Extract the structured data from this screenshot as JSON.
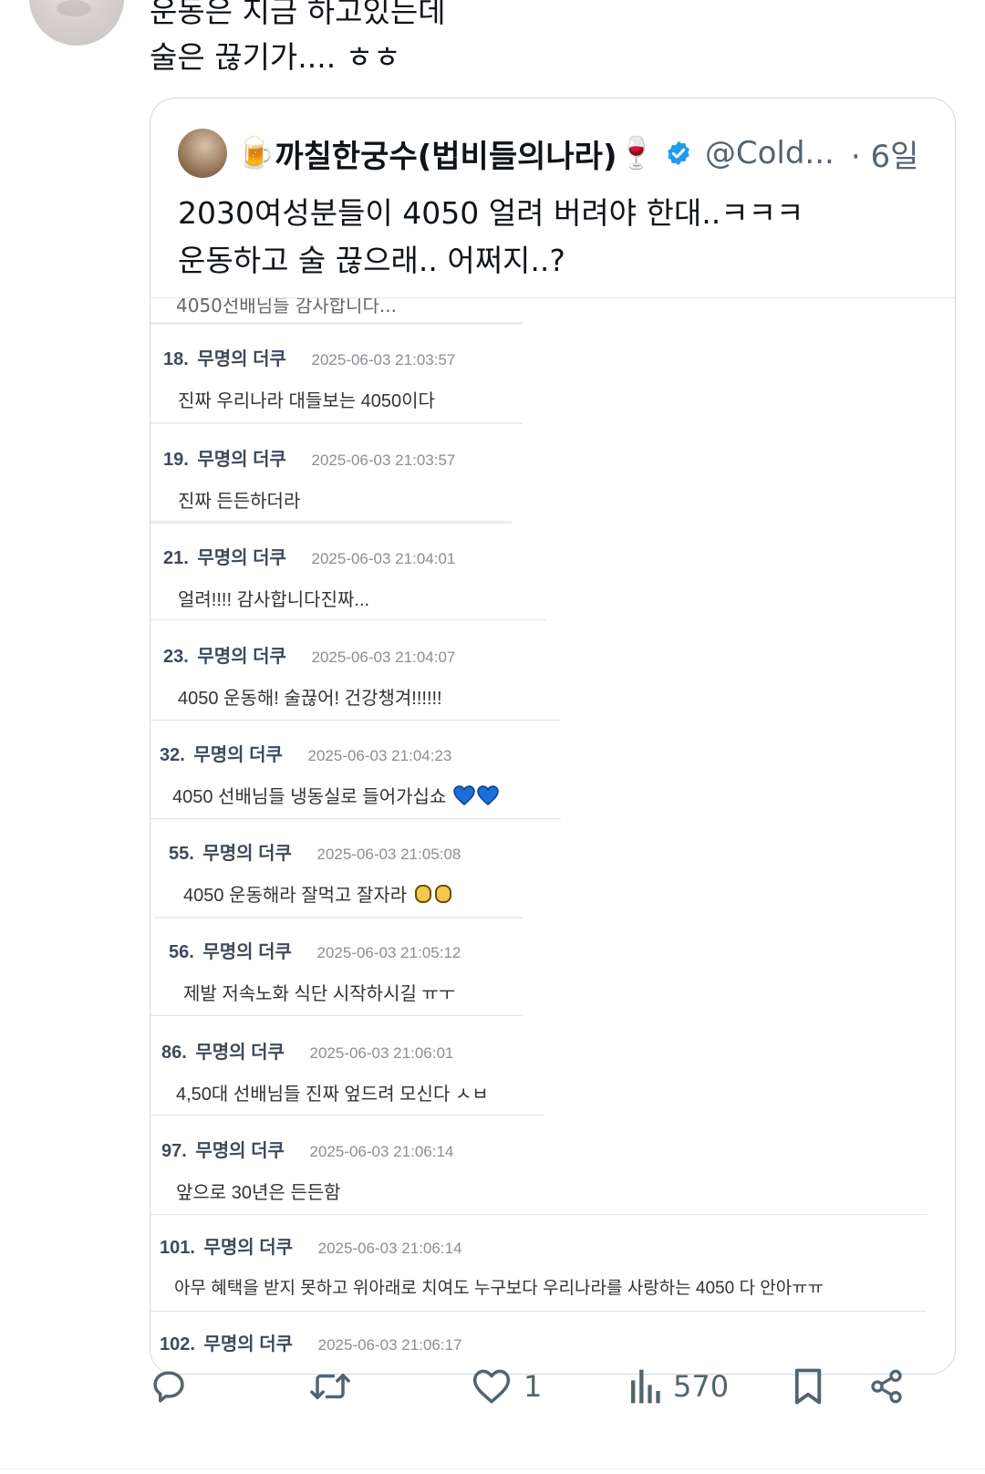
{
  "reply": {
    "line1": "운동은 지금 하고있는데",
    "line2": "술은 끊기가.... ㅎㅎ"
  },
  "quote": {
    "name_prefix_emoji": "🍺",
    "name": "까칠한궁수(법비들의나라)",
    "name_suffix_emoji": "🍷",
    "handle": "@Cold...",
    "time": "· 6일",
    "text_line1": "2030여성분들이 4050 얼려 버려야 한대..ㅋㅋㅋ",
    "text_line2": "운동하고 술 끊으래.. 어쩌지..?",
    "cut_top_text": "4050선배님들 감사합니다...",
    "comments": [
      {
        "num": "18.",
        "nick": "무명의 더쿠",
        "date": "2025-06-03 21:03:57",
        "body": "진짜 우리나라 대들보는 4050이다"
      },
      {
        "num": "19.",
        "nick": "무명의 더쿠",
        "date": "2025-06-03 21:03:57",
        "body": "진짜 든든하더라"
      },
      {
        "num": "21.",
        "nick": "무명의 더쿠",
        "date": "2025-06-03 21:04:01",
        "body": "얼려!!!! 감사합니다진짜..."
      },
      {
        "num": "23.",
        "nick": "무명의 더쿠",
        "date": "2025-06-03 21:04:07",
        "body": "4050 운동해! 술끊어! 건강챙겨!!!!!!"
      },
      {
        "num": "32.",
        "nick": "무명의 더쿠",
        "date": "2025-06-03 21:04:23",
        "body": "4050 선배님들 냉동실로 들어가십쇼"
      },
      {
        "num": "55.",
        "nick": "무명의 더쿠",
        "date": "2025-06-03 21:05:08",
        "body": "4050 운동해라 잘먹고 잘자라"
      },
      {
        "num": "56.",
        "nick": "무명의 더쿠",
        "date": "2025-06-03 21:05:12",
        "body": "제발 저속노화 식단 시작하시길 ㅠㅜ"
      },
      {
        "num": "86.",
        "nick": "무명의 더쿠",
        "date": "2025-06-03 21:06:01",
        "body": "4,50대 선배님들 진짜 엎드려 모신다 ㅅㅂ"
      },
      {
        "num": "97.",
        "nick": "무명의 더쿠",
        "date": "2025-06-03 21:06:14",
        "body": "앞으로 30년은 든든함"
      },
      {
        "num": "101.",
        "nick": "무명의 더쿠",
        "date": "2025-06-03 21:06:14",
        "body": "아무 혜택을 받지 못하고 위아래로 치여도 누구보다 우리나라를 사랑하는 4050 다 안아ㅠㅠ"
      },
      {
        "num": "102.",
        "nick": "무명의 더쿠",
        "date": "2025-06-03 21:06:17",
        "body": ""
      }
    ]
  },
  "actions": {
    "reply_icon": "reply-bubble-icon",
    "retweet_icon": "retweet-icon",
    "like_icon": "heart-icon",
    "like_count": "1",
    "views_icon": "bar-chart-icon",
    "views_count": "570",
    "bookmark_icon": "bookmark-icon",
    "share_icon": "share-icon"
  },
  "colors": {
    "verified": "#1d9bf0",
    "muted": "#536471",
    "border": "#cfd9de",
    "heart_emoji": "#1a6fd8",
    "fist_emoji": "#f2c94c"
  }
}
